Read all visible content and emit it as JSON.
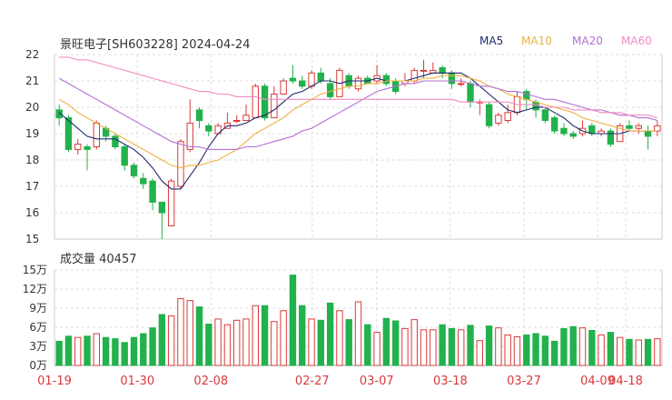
{
  "header": {
    "title": "景旺电子[SH603228] 2024-04-24",
    "ma_labels": [
      {
        "label": "MA5",
        "color": "#1f2a6b"
      },
      {
        "label": "MA10",
        "color": "#f0b042"
      },
      {
        "label": "MA20",
        "color": "#b46fd6"
      },
      {
        "label": "MA60",
        "color": "#f08cc0"
      }
    ]
  },
  "volume_header": {
    "text": "成交量 40457"
  },
  "colors": {
    "up": "#d93a3a",
    "down": "#22b14c",
    "grid": "#dddddd"
  },
  "chart_data": [
    {
      "type": "candlestick",
      "title": "景旺电子[SH603228] 2024-04-24",
      "ylim": [
        15,
        22
      ],
      "y_ticks": [
        "22",
        "21",
        "20",
        "19",
        "18",
        "17",
        "16",
        "15"
      ],
      "x_ticks": [
        "01-19",
        "01-30",
        "02-08",
        "02-27",
        "03-07",
        "03-18",
        "03-27",
        "04-09",
        "04-18"
      ],
      "candles": [
        [
          19.9,
          19.6,
          20.1,
          19.3
        ],
        [
          19.6,
          18.4,
          19.7,
          18.3
        ],
        [
          18.4,
          18.6,
          18.8,
          18.2
        ],
        [
          18.5,
          18.4,
          18.6,
          17.6
        ],
        [
          18.5,
          19.4,
          19.5,
          18.4
        ],
        [
          19.2,
          18.9,
          19.3,
          18.7
        ],
        [
          18.9,
          18.5,
          19.0,
          18.4
        ],
        [
          18.5,
          17.8,
          18.6,
          17.6
        ],
        [
          17.8,
          17.4,
          17.9,
          17.3
        ],
        [
          17.3,
          17.1,
          17.5,
          16.9
        ],
        [
          17.2,
          16.4,
          17.3,
          16.1
        ],
        [
          16.4,
          16.0,
          16.4,
          15.0
        ],
        [
          15.5,
          17.2,
          17.3,
          15.5
        ],
        [
          17.0,
          18.7,
          18.8,
          16.9
        ],
        [
          18.4,
          19.4,
          20.3,
          18.3
        ],
        [
          19.9,
          19.5,
          20.0,
          19.2
        ],
        [
          19.3,
          19.1,
          19.4,
          18.9
        ],
        [
          19.0,
          19.3,
          19.4,
          19.0
        ],
        [
          19.2,
          19.4,
          19.8,
          19.2
        ],
        [
          19.5,
          19.5,
          19.7,
          19.4
        ],
        [
          19.5,
          19.7,
          20.1,
          19.5
        ],
        [
          19.6,
          20.8,
          20.9,
          19.6
        ],
        [
          20.8,
          19.6,
          20.9,
          19.5
        ],
        [
          19.6,
          20.5,
          20.8,
          19.6
        ],
        [
          20.5,
          21.0,
          21.1,
          20.5
        ],
        [
          21.1,
          21.0,
          21.6,
          20.9
        ],
        [
          21.0,
          20.8,
          21.2,
          20.7
        ],
        [
          20.8,
          21.3,
          21.4,
          20.7
        ],
        [
          21.3,
          21.0,
          21.5,
          20.9
        ],
        [
          20.9,
          20.4,
          21.1,
          20.3
        ],
        [
          20.4,
          21.4,
          21.5,
          20.4
        ],
        [
          21.2,
          20.8,
          21.3,
          20.7
        ],
        [
          20.7,
          21.1,
          21.2,
          20.6
        ],
        [
          21.1,
          20.9,
          21.2,
          20.9
        ],
        [
          21.0,
          21.2,
          21.6,
          20.9
        ],
        [
          21.2,
          20.9,
          21.3,
          20.8
        ],
        [
          21.0,
          20.6,
          21.1,
          20.5
        ],
        [
          20.9,
          21.0,
          21.3,
          20.8
        ],
        [
          21.0,
          21.4,
          21.5,
          20.9
        ],
        [
          21.4,
          21.4,
          21.8,
          21.1
        ],
        [
          21.3,
          21.4,
          21.7,
          21.3
        ],
        [
          21.5,
          21.3,
          21.6,
          21.1
        ],
        [
          21.3,
          20.9,
          21.4,
          20.7
        ],
        [
          20.9,
          20.9,
          21.1,
          20.8
        ],
        [
          20.9,
          20.2,
          21.0,
          20.0
        ],
        [
          20.2,
          20.2,
          20.3,
          19.7
        ],
        [
          20.1,
          19.3,
          20.2,
          19.2
        ],
        [
          19.4,
          19.7,
          19.8,
          19.3
        ],
        [
          19.5,
          19.8,
          20.1,
          19.4
        ],
        [
          19.8,
          20.4,
          20.6,
          19.7
        ],
        [
          20.6,
          20.3,
          20.7,
          19.9
        ],
        [
          20.2,
          19.9,
          20.3,
          19.6
        ],
        [
          19.9,
          19.5,
          20.0,
          19.4
        ],
        [
          19.6,
          19.1,
          19.7,
          19.0
        ],
        [
          19.2,
          19.0,
          19.4,
          18.9
        ],
        [
          19.0,
          18.9,
          19.1,
          18.8
        ],
        [
          19.0,
          19.2,
          19.5,
          18.9
        ],
        [
          19.3,
          19.0,
          19.4,
          18.9
        ],
        [
          19.0,
          19.1,
          19.2,
          18.9
        ],
        [
          19.1,
          18.6,
          19.2,
          18.5
        ],
        [
          18.7,
          19.3,
          19.4,
          18.7
        ],
        [
          19.3,
          19.2,
          19.5,
          19.1
        ],
        [
          19.2,
          19.3,
          19.4,
          19.0
        ],
        [
          19.1,
          18.9,
          19.3,
          18.4
        ],
        [
          19.1,
          19.3,
          19.5,
          18.9
        ]
      ],
      "series": [
        {
          "name": "MA5",
          "values": [
            19.8,
            19.5,
            19.2,
            18.9,
            18.8,
            18.8,
            18.8,
            18.6,
            18.4,
            18.1,
            17.7,
            17.2,
            16.9,
            16.9,
            17.4,
            17.9,
            18.5,
            19.0,
            19.3,
            19.3,
            19.4,
            19.6,
            19.7,
            19.9,
            20.2,
            20.5,
            20.6,
            20.8,
            21.0,
            21.0,
            20.9,
            21.0,
            21.0,
            21.0,
            21.1,
            21.0,
            21.0,
            21.0,
            21.1,
            21.2,
            21.3,
            21.3,
            21.3,
            21.3,
            21.1,
            20.8,
            20.5,
            20.2,
            19.9,
            19.8,
            19.9,
            20.0,
            20.0,
            19.8,
            19.6,
            19.3,
            19.1,
            19.0,
            19.0,
            19.0,
            19.0,
            19.1,
            19.1,
            19.1,
            19.1
          ]
        },
        {
          "name": "MA10",
          "values": [
            20.3,
            20.1,
            19.8,
            19.6,
            19.4,
            19.2,
            19.0,
            18.8,
            18.6,
            18.4,
            18.2,
            18.0,
            17.8,
            17.7,
            17.8,
            17.8,
            17.9,
            18.0,
            18.2,
            18.4,
            18.7,
            19.0,
            19.2,
            19.4,
            19.6,
            19.9,
            20.1,
            20.3,
            20.5,
            20.6,
            20.7,
            20.8,
            20.8,
            20.9,
            20.9,
            21.0,
            21.0,
            21.0,
            21.0,
            21.1,
            21.1,
            21.2,
            21.2,
            21.2,
            21.1,
            21.0,
            20.8,
            20.7,
            20.5,
            20.4,
            20.3,
            20.2,
            20.1,
            20.0,
            19.9,
            19.8,
            19.6,
            19.5,
            19.4,
            19.3,
            19.2,
            19.1,
            19.1,
            19.1,
            19.1
          ]
        },
        {
          "name": "MA20",
          "values": [
            21.1,
            20.9,
            20.7,
            20.5,
            20.3,
            20.1,
            19.9,
            19.7,
            19.5,
            19.3,
            19.1,
            18.9,
            18.7,
            18.6,
            18.5,
            18.5,
            18.4,
            18.4,
            18.4,
            18.4,
            18.5,
            18.5,
            18.6,
            18.7,
            18.8,
            18.9,
            19.1,
            19.2,
            19.4,
            19.6,
            19.8,
            20.0,
            20.2,
            20.4,
            20.6,
            20.7,
            20.8,
            20.9,
            20.9,
            21.0,
            21.0,
            21.0,
            21.0,
            21.0,
            20.9,
            20.8,
            20.8,
            20.7,
            20.6,
            20.6,
            20.5,
            20.4,
            20.3,
            20.3,
            20.2,
            20.1,
            20.0,
            19.9,
            19.9,
            19.8,
            19.7,
            19.7,
            19.6,
            19.6,
            19.5
          ]
        },
        {
          "name": "MA60",
          "values": [
            21.9,
            21.9,
            21.8,
            21.8,
            21.7,
            21.6,
            21.5,
            21.4,
            21.3,
            21.2,
            21.1,
            21.0,
            20.9,
            20.8,
            20.7,
            20.6,
            20.6,
            20.5,
            20.5,
            20.4,
            20.4,
            20.4,
            20.3,
            20.3,
            20.3,
            20.3,
            20.3,
            20.3,
            20.3,
            20.3,
            20.3,
            20.3,
            20.3,
            20.3,
            20.3,
            20.3,
            20.3,
            20.3,
            20.3,
            20.3,
            20.3,
            20.3,
            20.3,
            20.2,
            20.2,
            20.2,
            20.2,
            20.2,
            20.2,
            20.1,
            20.1,
            20.1,
            20.0,
            20.0,
            20.0,
            19.9,
            19.9,
            19.9,
            19.8,
            19.8,
            19.8,
            19.7,
            19.7,
            19.7,
            19.6
          ]
        }
      ]
    },
    {
      "type": "bar",
      "title": "成交量 40457",
      "ylim": [
        0,
        15
      ],
      "y_ticks": [
        "15万",
        "12万",
        "9万",
        "6万",
        "3万",
        "0万"
      ],
      "values": [
        3.8,
        4.6,
        4.4,
        4.6,
        5.0,
        4.4,
        4.2,
        3.6,
        4.4,
        5.0,
        5.9,
        8.0,
        7.8,
        10.5,
        10.2,
        9.2,
        6.5,
        7.3,
        6.4,
        7.1,
        7.3,
        9.4,
        9.4,
        6.9,
        8.6,
        14.2,
        9.4,
        7.3,
        7.1,
        9.8,
        8.6,
        7.2,
        10.0,
        6.4,
        5.2,
        7.4,
        7.0,
        5.8,
        7.2,
        5.6,
        5.6,
        6.4,
        5.8,
        5.6,
        6.3,
        3.9,
        6.2,
        5.9,
        4.8,
        4.5,
        4.8,
        5.0,
        4.6,
        3.8,
        5.8,
        6.1,
        5.9,
        5.5,
        4.8,
        5.2,
        4.4,
        4.1,
        4.0,
        4.1,
        4.2
      ]
    }
  ]
}
